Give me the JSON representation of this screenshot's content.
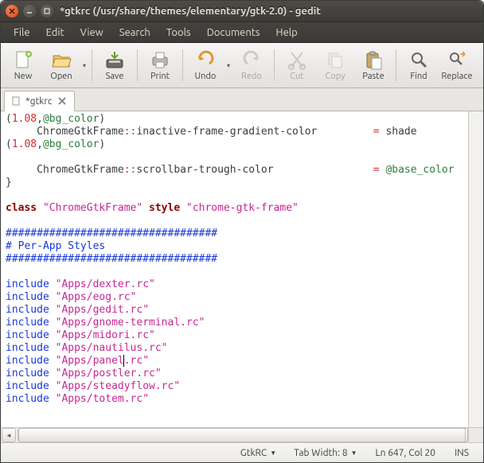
{
  "window": {
    "title": "*gtkrc (/usr/share/themes/elementary/gtk-2.0) - gedit"
  },
  "menu": {
    "file": "File",
    "edit": "Edit",
    "view": "View",
    "search": "Search",
    "tools": "Tools",
    "documents": "Documents",
    "help": "Help"
  },
  "toolbar": {
    "new": "New",
    "open": "Open",
    "save": "Save",
    "print": "Print",
    "undo": "Undo",
    "redo": "Redo",
    "cut": "Cut",
    "copy": "Copy",
    "paste": "Paste",
    "find": "Find",
    "replace": "Replace"
  },
  "tabs": {
    "current": "*gtkrc"
  },
  "editor": {
    "line1a": "(",
    "line1b": "1.08",
    "line1c": ",",
    "line1d": "@bg_color",
    "line1e": ")",
    "line2a": "     ChromeGtkFrame",
    "line2b": "::",
    "line2c": "inactive-frame-gradient-color         ",
    "line2d": "= ",
    "line2e": "shade",
    "line3a": "(",
    "line3b": "1.08",
    "line3c": ",",
    "line3d": "@bg_color",
    "line3e": ")",
    "line4": "",
    "line5a": "     ChromeGtkFrame",
    "line5b": "::",
    "line5c": "scrollbar-trough-color                ",
    "line5d": "= ",
    "line5e": "@base_color",
    "line6": "}",
    "line7": "",
    "line8a": "class ",
    "line8b": "\"ChromeGtkFrame\" ",
    "line8c": "style ",
    "line8d": "\"chrome-gtk-frame\"",
    "line9": "",
    "line10": "##################################",
    "line11": "# Per-App Styles",
    "line12": "##################################",
    "line13": "",
    "inc": "include ",
    "f1": "\"Apps/dexter.rc\"",
    "f2": "\"Apps/eog.rc\"",
    "f3": "\"Apps/gedit.rc\"",
    "f4": "\"Apps/gnome-terminal.rc\"",
    "f5": "\"Apps/midori.rc\"",
    "f6": "\"Apps/nautilus.rc\"",
    "f7a": "\"Apps/panel",
    "f7b": ".rc\"",
    "f8": "\"Apps/postler.rc\"",
    "f9": "\"Apps/steadyflow.rc\"",
    "f10": "\"Apps/totem.rc\""
  },
  "status": {
    "syntax": "GtkRC",
    "tabwidth": "Tab Width: 8",
    "position": "Ln 647, Col 20",
    "insert": "INS"
  }
}
